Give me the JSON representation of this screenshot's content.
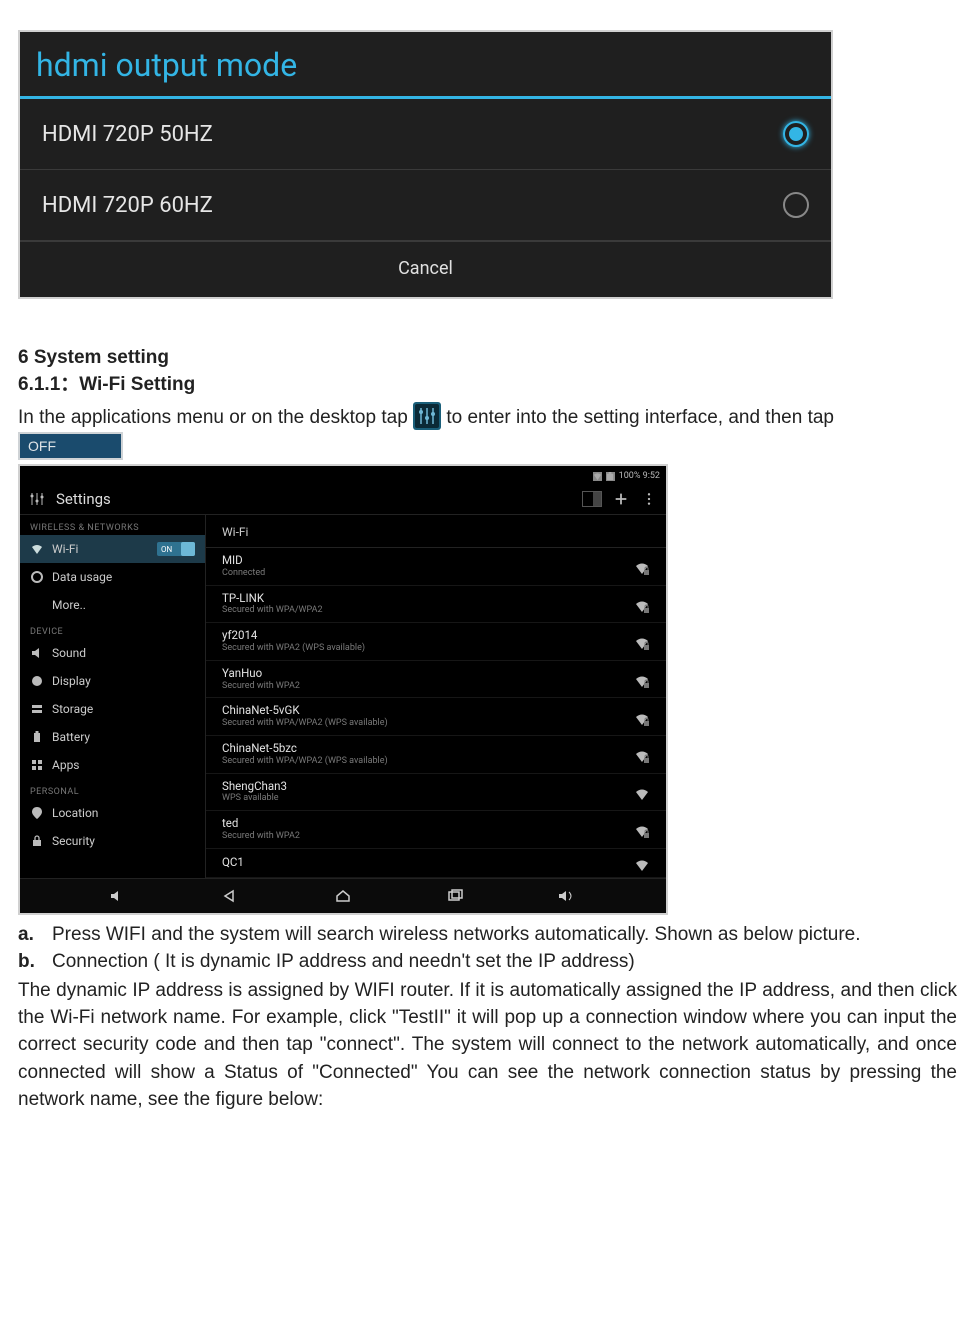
{
  "hdmi_dialog": {
    "title": "hdmi output mode",
    "options": [
      {
        "label": "HDMI 720P 50HZ",
        "selected": true
      },
      {
        "label": "HDMI 720P 60HZ",
        "selected": false
      }
    ],
    "cancel": "Cancel"
  },
  "headings": {
    "h6": "6 System setting",
    "h611": "6.1.1：Wi-Fi Setting"
  },
  "intro": {
    "part1": "In the applications menu or on the desktop tap ",
    "part2": " to enter into the setting interface, and then tap "
  },
  "off_badge": "OFF",
  "settings_shot": {
    "status_time": "100% 9:52",
    "title": "Settings",
    "pane_title": "Wi-Fi",
    "side_categories": {
      "wireless": "WIRELESS & NETWORKS",
      "device": "DEVICE",
      "personal": "PERSONAL"
    },
    "side_items": {
      "wifi": "Wi-Fi",
      "wifi_on": "ON",
      "data": "Data usage",
      "more": "More..",
      "sound": "Sound",
      "display": "Display",
      "storage": "Storage",
      "battery": "Battery",
      "apps": "Apps",
      "location": "Location",
      "security": "Security"
    },
    "networks": [
      {
        "name": "MID",
        "sub": "Connected",
        "lock": true
      },
      {
        "name": "TP-LINK",
        "sub": "Secured with WPA/WPA2",
        "lock": true
      },
      {
        "name": "yf2014",
        "sub": "Secured with WPA2 (WPS available)",
        "lock": true
      },
      {
        "name": "YanHuo",
        "sub": "Secured with WPA2",
        "lock": true
      },
      {
        "name": "ChinaNet-5vGK",
        "sub": "Secured with WPA/WPA2 (WPS available)",
        "lock": true
      },
      {
        "name": "ChinaNet-5bzc",
        "sub": "Secured with WPA/WPA2 (WPS available)",
        "lock": true
      },
      {
        "name": "ShengChan3",
        "sub": "WPS available",
        "lock": false
      },
      {
        "name": "ted",
        "sub": "Secured with WPA2",
        "lock": true
      },
      {
        "name": "QC1",
        "sub": "",
        "lock": false
      }
    ]
  },
  "list_items": {
    "a_bullet": "a.",
    "a_text": "Press WIFI and the system will search wireless networks automatically. Shown as below picture.",
    "b_bullet": "b.",
    "b_text": "Connection ( It is dynamic IP address and needn't set the IP address)"
  },
  "bottom_para": "The dynamic IP address is assigned by WIFI router. If it is automatically assigned the IP address, and then click the Wi-Fi network name. For example, click \"TestII\" it will pop up a connection window where you can input the correct security code and then tap \"connect\". The system will connect to the network automatically, and once connected will show a Status of \"Connected\" You can see the network connection status by pressing the network name, see the figure below:"
}
